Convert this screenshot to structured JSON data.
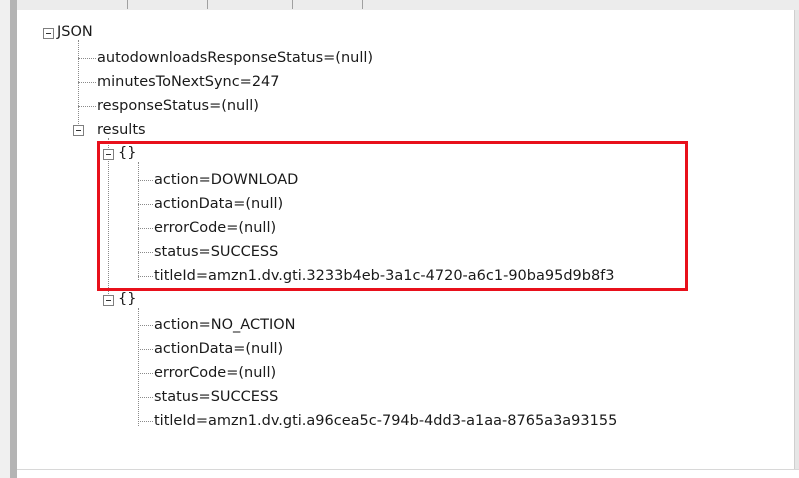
{
  "tree": {
    "root": {
      "label": "JSON"
    },
    "fields": [
      {
        "label": "autodownloadsResponseStatus=(null)"
      },
      {
        "label": "minutesToNextSync=247"
      },
      {
        "label": "responseStatus=(null)"
      }
    ],
    "results": {
      "label": "results",
      "items": [
        {
          "label": "{}",
          "highlighted": true,
          "children": [
            {
              "label": "action=DOWNLOAD"
            },
            {
              "label": "actionData=(null)"
            },
            {
              "label": "errorCode=(null)"
            },
            {
              "label": "status=SUCCESS"
            },
            {
              "label": "titleId=amzn1.dv.gti.3233b4eb-3a1c-4720-a6c1-90ba95d9b8f3"
            }
          ]
        },
        {
          "label": "{}",
          "highlighted": false,
          "children": [
            {
              "label": "action=NO_ACTION"
            },
            {
              "label": "actionData=(null)"
            },
            {
              "label": "errorCode=(null)"
            },
            {
              "label": "status=SUCCESS"
            },
            {
              "label": "titleId=amzn1.dv.gti.a96cea5c-794b-4dd3-a1aa-8765a3a93155"
            }
          ]
        }
      ]
    }
  },
  "colors": {
    "highlight_border": "#e8101b",
    "text": "#1a1a1a",
    "tree_lines": "#8a8a8a"
  }
}
